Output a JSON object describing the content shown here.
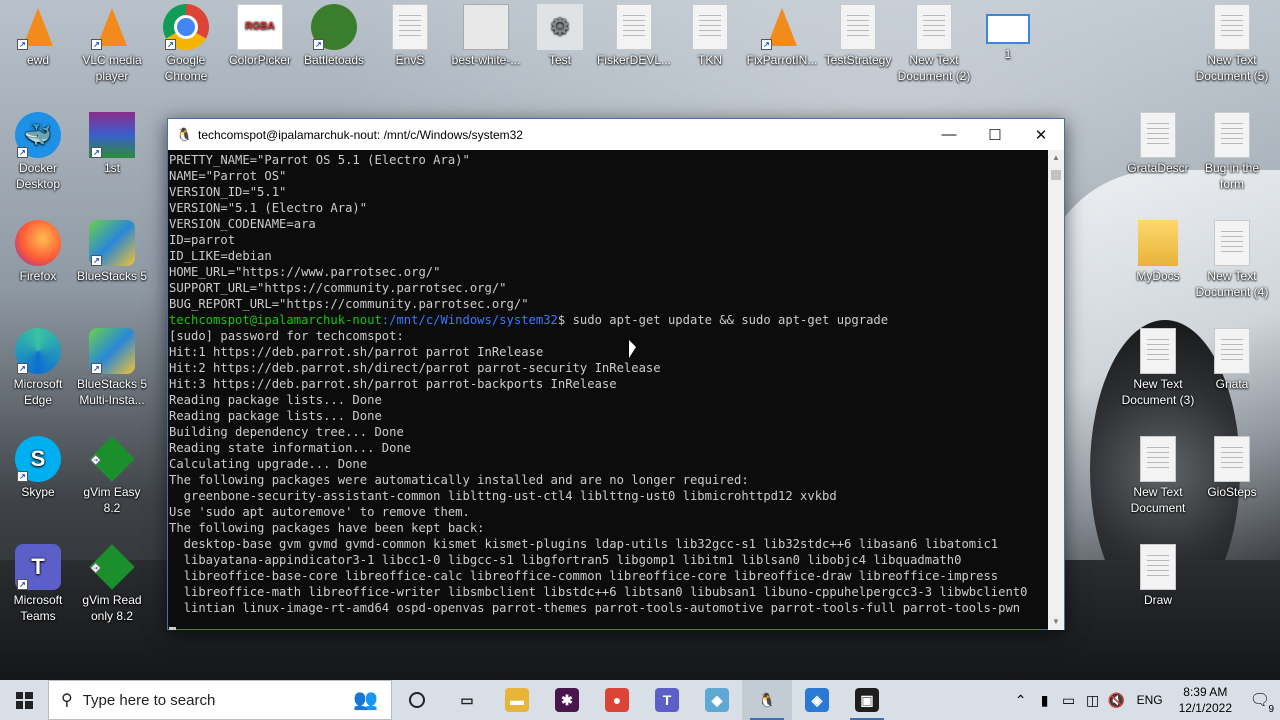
{
  "desktop": {
    "icons": [
      {
        "label": "ewd",
        "type": "vlc",
        "glyph": "",
        "x": 0
      },
      {
        "label": "VLC media player",
        "type": "vlc",
        "glyph": ""
      },
      {
        "label": "Google Chrome",
        "type": "chrome",
        "glyph": ""
      },
      {
        "label": "ColorPicker",
        "type": "rgba",
        "glyph": "RGBA"
      },
      {
        "label": "Battletoads",
        "type": "toad",
        "glyph": ""
      },
      {
        "label": "EnvS",
        "type": "doc",
        "glyph": ""
      },
      {
        "label": "best-white-...",
        "type": "img",
        "glyph": ""
      },
      {
        "label": "Test",
        "type": "gear",
        "glyph": "⚙"
      },
      {
        "label": "FiskerDEVL...",
        "type": "doc",
        "glyph": ""
      },
      {
        "label": "TKN",
        "type": "doc",
        "glyph": ""
      },
      {
        "label": "FixParrotIN...",
        "type": "vlc",
        "glyph": ""
      },
      {
        "label": "TestStrategy",
        "type": "doc",
        "glyph": ""
      },
      {
        "label": "New Text Document (2)",
        "type": "doc",
        "glyph": ""
      },
      {
        "label": "1",
        "type": "win",
        "glyph": ""
      },
      {
        "label": "New Text Document (5)",
        "type": "doc",
        "glyph": ""
      },
      {
        "label": "Docker Desktop",
        "type": "docker",
        "glyph": "🐳"
      },
      {
        "label": "1st",
        "type": "rar",
        "glyph": ""
      },
      {
        "label": "GrataDescr",
        "type": "doc",
        "glyph": ""
      },
      {
        "label": "Bug in the form",
        "type": "doc",
        "glyph": ""
      },
      {
        "label": "Firefox",
        "type": "firefox",
        "glyph": ""
      },
      {
        "label": "BlueStacks 5",
        "type": "blue",
        "glyph": ""
      },
      {
        "label": "MyDocs",
        "type": "folder",
        "glyph": ""
      },
      {
        "label": "New Text Document (4)",
        "type": "doc",
        "glyph": ""
      },
      {
        "label": "Microsoft Edge",
        "type": "edge",
        "glyph": ""
      },
      {
        "label": "BlueStacks 5 Multi-Insta...",
        "type": "blue",
        "glyph": ""
      },
      {
        "label": "New Text Document (3)",
        "type": "doc",
        "glyph": ""
      },
      {
        "label": "Gnata",
        "type": "doc",
        "glyph": ""
      },
      {
        "label": "Skype",
        "type": "skype",
        "glyph": "S"
      },
      {
        "label": "gVim Easy 8.2",
        "type": "vim",
        "glyph": ""
      },
      {
        "label": "New Text Document",
        "type": "doc",
        "glyph": ""
      },
      {
        "label": "GioSteps",
        "type": "doc",
        "glyph": ""
      },
      {
        "label": "Microsoft Teams",
        "type": "teams",
        "glyph": "T"
      },
      {
        "label": "gVim Read only 8.2",
        "type": "vim",
        "glyph": ""
      },
      {
        "label": "Draw",
        "type": "doc",
        "glyph": ""
      }
    ]
  },
  "terminal": {
    "title": "techcomspot@ipalamarchuk-nout: /mnt/c/Windows/system32",
    "minimize": "—",
    "maximize": "☐",
    "close": "✕",
    "lines": [
      {
        "text": "PRETTY_NAME=\"Parrot OS 5.1 (Electro Ara)\""
      },
      {
        "text": "NAME=\"Parrot OS\""
      },
      {
        "text": "VERSION_ID=\"5.1\""
      },
      {
        "text": "VERSION=\"5.1 (Electro Ara)\""
      },
      {
        "text": "VERSION_CODENAME=ara"
      },
      {
        "text": "ID=parrot"
      },
      {
        "text": "ID_LIKE=debian"
      },
      {
        "text": "HOME_URL=\"https://www.parrotsec.org/\""
      },
      {
        "text": "SUPPORT_URL=\"https://community.parrotsec.org/\""
      },
      {
        "text": "BUG_REPORT_URL=\"https://community.parrotsec.org/\""
      },
      {
        "user": "techcomspot@ipalamarchuk-nout",
        "path": ":/mnt/c/Windows/system32",
        "text": "$ sudo apt-get update && sudo apt-get upgrade"
      },
      {
        "text": "[sudo] password for techcomspot:"
      },
      {
        "text": "Hit:1 https://deb.parrot.sh/parrot parrot InRelease"
      },
      {
        "text": "Hit:2 https://deb.parrot.sh/direct/parrot parrot-security InRelease"
      },
      {
        "text": "Hit:3 https://deb.parrot.sh/parrot parrot-backports InRelease"
      },
      {
        "text": "Reading package lists... Done"
      },
      {
        "text": "Reading package lists... Done"
      },
      {
        "text": "Building dependency tree... Done"
      },
      {
        "text": "Reading state information... Done"
      },
      {
        "text": "Calculating upgrade... Done"
      },
      {
        "text": "The following packages were automatically installed and are no longer required:"
      },
      {
        "text": "  greenbone-security-assistant-common liblttng-ust-ctl4 liblttng-ust0 libmicrohttpd12 xvkbd"
      },
      {
        "text": "Use 'sudo apt autoremove' to remove them."
      },
      {
        "text": "The following packages have been kept back:"
      },
      {
        "text": "  desktop-base gvm gvmd gvmd-common kismet kismet-plugins ldap-utils lib32gcc-s1 lib32stdc++6 libasan6 libatomic1"
      },
      {
        "text": "  libayatana-appindicator3-1 libcc1-0 libgcc-s1 libgfortran5 libgomp1 libitm1 liblsan0 libobjc4 libquadmath0"
      },
      {
        "text": "  libreoffice-base-core libreoffice-calc libreoffice-common libreoffice-core libreoffice-draw libreoffice-impress"
      },
      {
        "text": "  libreoffice-math libreoffice-writer libsmbclient libstdc++6 libtsan0 libubsan1 libuno-cppuhelpergcc3-3 libwbclient0"
      },
      {
        "text": "  lintian linux-image-rt-amd64 ospd-openvas parrot-themes parrot-tools-automotive parrot-tools-full parrot-tools-pwn"
      }
    ]
  },
  "taskbar": {
    "search_placeholder": "Type here to search",
    "apps": [
      {
        "name": "task-view",
        "glyph": "▭",
        "color": "#333333"
      },
      {
        "name": "file-explorer",
        "glyph": "▬",
        "color": "#e8b43a"
      },
      {
        "name": "slack",
        "glyph": "✱",
        "color": "#4a154b"
      },
      {
        "name": "chrome",
        "glyph": "●",
        "color": "#db4437"
      },
      {
        "name": "teams",
        "glyph": "T",
        "color": "#5b5fc7"
      },
      {
        "name": "notepad-app",
        "glyph": "◆",
        "color": "#5fa8d3"
      },
      {
        "name": "linux-terminal",
        "glyph": "🐧",
        "color": "#222222"
      },
      {
        "name": "azure-app",
        "glyph": "◈",
        "color": "#2a7ad5"
      },
      {
        "name": "console",
        "glyph": "▣",
        "color": "#1e1e1e"
      }
    ],
    "tray": {
      "language": "ENG",
      "time": "8:39 AM",
      "date": "12/1/2022",
      "notifications": "9"
    }
  }
}
